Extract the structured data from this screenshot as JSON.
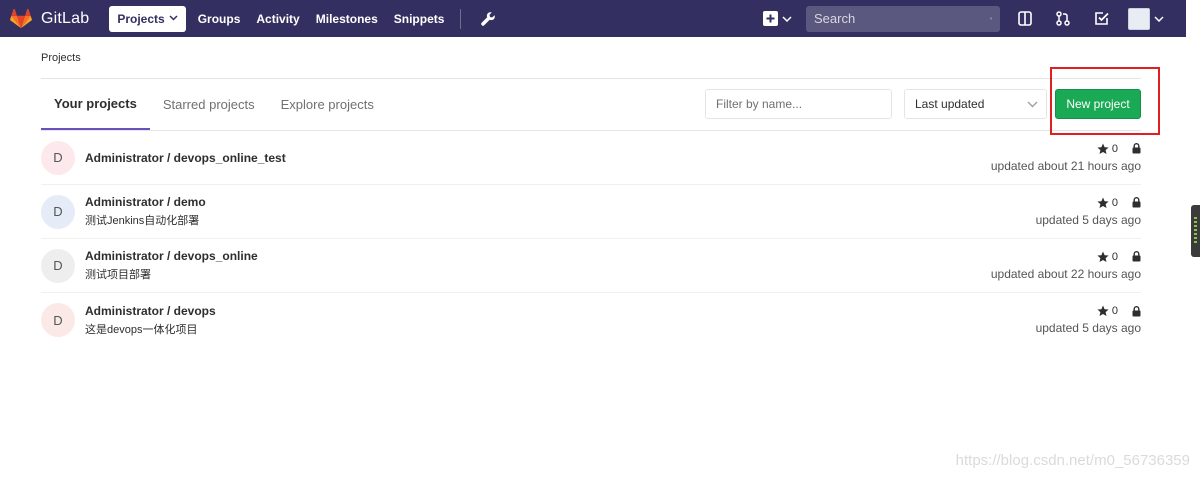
{
  "navbar": {
    "brand": "GitLab",
    "links": [
      {
        "label": "Projects",
        "active": true,
        "dropdown": true
      },
      {
        "label": "Groups"
      },
      {
        "label": "Activity"
      },
      {
        "label": "Milestones"
      },
      {
        "label": "Snippets"
      }
    ],
    "search_placeholder": "Search",
    "icons": [
      "wrench-icon",
      "plus-square-icon",
      "search-icon",
      "issues-board-icon",
      "merge-request-icon",
      "todo-check-icon",
      "user-avatar"
    ]
  },
  "breadcrumb": "Projects",
  "tabs": [
    {
      "label": "Your projects",
      "active": true
    },
    {
      "label": "Starred projects"
    },
    {
      "label": "Explore projects"
    }
  ],
  "filter": {
    "placeholder": "Filter by name..."
  },
  "sort": {
    "selected": "Last updated"
  },
  "new_project_label": "New project",
  "projects": [
    {
      "initial": "D",
      "name": "Administrator / devops_online_test",
      "description": "",
      "stars": "0",
      "updated": "updated about 21 hours ago",
      "avatar_color": "#fde8ec"
    },
    {
      "initial": "D",
      "name": "Administrator / demo",
      "description": "测试Jenkins自动化部署",
      "stars": "0",
      "updated": "updated 5 days ago",
      "avatar_color": "#e6ecf7"
    },
    {
      "initial": "D",
      "name": "Administrator / devops_online",
      "description": "测试项目部署",
      "stars": "0",
      "updated": "updated about 22 hours ago",
      "avatar_color": "#eeeeee"
    },
    {
      "initial": "D",
      "name": "Administrator / devops",
      "description": "这是devops一体化项目",
      "stars": "0",
      "updated": "updated 5 days ago",
      "avatar_color": "#fbe9e7"
    }
  ],
  "watermark": "https://blog.csdn.net/m0_56736359",
  "colors": {
    "navbar": "#332f61",
    "new_button": "#1aaa55",
    "tab_active": "#6b4fbb",
    "highlight": "#e02020"
  }
}
